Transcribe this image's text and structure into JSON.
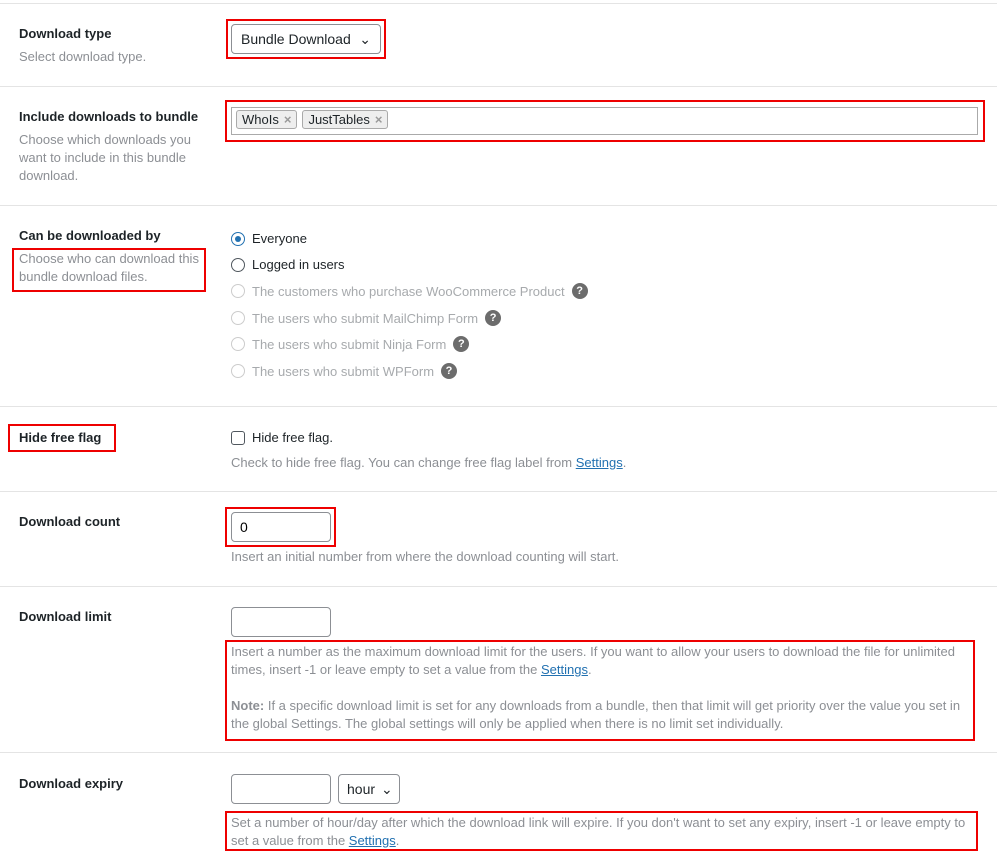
{
  "download_type": {
    "label": "Download type",
    "desc": "Select download type.",
    "value": "Bundle Download"
  },
  "bundle": {
    "label": "Include downloads to bundle",
    "desc": "Choose which downloads you want to include in this bundle download.",
    "tags": [
      "WhoIs",
      "JustTables"
    ]
  },
  "downloaded_by": {
    "label": "Can be downloaded by",
    "desc": "Choose who can download this bundle download files.",
    "options": [
      {
        "label": "Everyone",
        "checked": true,
        "disabled": false
      },
      {
        "label": "Logged in users",
        "checked": false,
        "disabled": false
      },
      {
        "label": "The customers who purchase WooCommerce Product",
        "disabled": true
      },
      {
        "label": "The users who submit MailChimp Form",
        "disabled": true
      },
      {
        "label": "The users who submit Ninja Form",
        "disabled": true
      },
      {
        "label": "The users who submit WPForm",
        "disabled": true
      }
    ],
    "help": "?"
  },
  "free_flag": {
    "label": "Hide free flag",
    "checkbox_label": "Hide free flag.",
    "desc": "Check to hide free flag. You can change free flag label from ",
    "link": "Settings",
    "end": "."
  },
  "download_count": {
    "label": "Download count",
    "value": "0",
    "desc": "Insert an initial number from where the download counting will start."
  },
  "download_limit": {
    "label": "Download limit",
    "value": "",
    "desc": "Insert a number as the maximum download limit for the users. If you want to allow your users to download the file for unlimited times, insert -1 or leave empty to set a value from the ",
    "link": "Settings",
    "end": ".",
    "note_label": "Note:",
    "note": " If a specific download limit is set for any downloads from a bundle, then that limit will get priority over the value you set in the global Settings. The global settings will only be applied when there is no limit set individually."
  },
  "download_expiry": {
    "label": "Download expiry",
    "value": "",
    "unit": "hour",
    "desc": "Set a number of hour/day after which the download link will expire. If you don't want to set any expiry, insert -1 or leave empty to set a value from the ",
    "link": "Settings",
    "end": "."
  },
  "colors": {
    "highlight": "#ee0000",
    "link": "#2271b1"
  }
}
